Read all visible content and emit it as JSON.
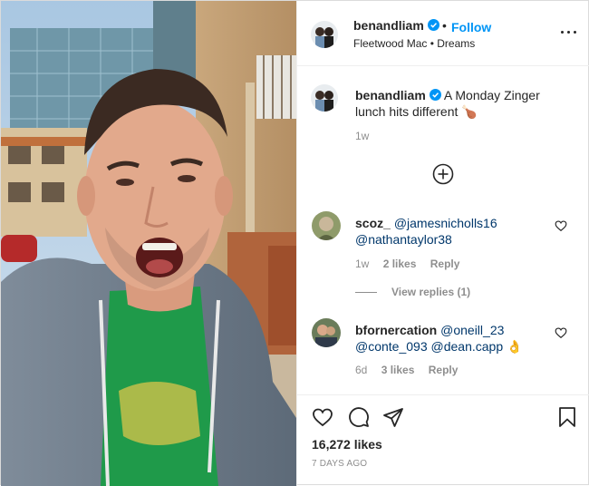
{
  "header": {
    "username": "benandliam",
    "follow_label": "Follow",
    "separator": "•",
    "audio": "Fleetwood Mac • Dreams"
  },
  "caption": {
    "username": "benandliam",
    "text": "A Monday Zinger lunch hits different",
    "emoji": "🍗",
    "time": "1w"
  },
  "comments": [
    {
      "username": "scoz_",
      "mentions": [
        "@jamesnicholls16",
        "@nathantaylor38"
      ],
      "time": "1w",
      "likes": "2 likes",
      "reply_label": "Reply",
      "view_replies": "View replies (1)"
    },
    {
      "username": "bfornercation",
      "mentions": [
        "@oneill_23",
        "@conte_093",
        "@dean.capp"
      ],
      "emoji": "👌",
      "time": "6d",
      "likes": "3 likes",
      "reply_label": "Reply"
    }
  ],
  "footer": {
    "likes": "16,272 likes",
    "posted": "7 DAYS AGO"
  },
  "colors": {
    "accent": "#0095f6",
    "mention": "#00376b",
    "muted": "#8e8e8e",
    "text": "#262626"
  },
  "icons": [
    "verified-badge-icon",
    "more-options-icon",
    "add-circle-icon",
    "heart-icon",
    "comment-icon",
    "share-icon",
    "bookmark-icon"
  ]
}
